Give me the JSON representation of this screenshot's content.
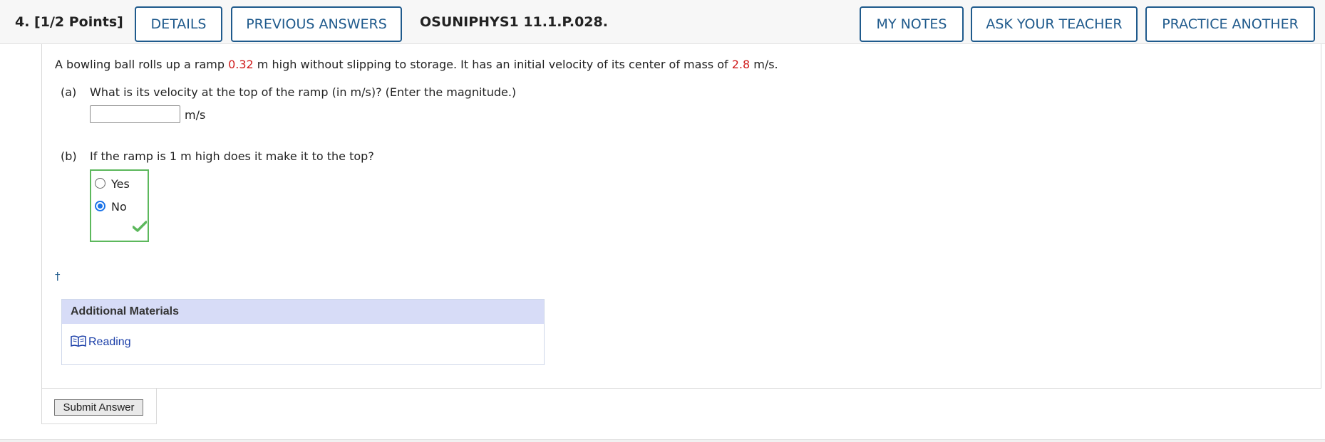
{
  "header": {
    "question_label": "4.  [1/2 Points]",
    "details_label": "DETAILS",
    "previous_answers_label": "PREVIOUS ANSWERS",
    "question_code": "OSUNIPHYS1 11.1.P.028.",
    "my_notes_label": "MY NOTES",
    "ask_teacher_label": "ASK YOUR TEACHER",
    "practice_another_label": "PRACTICE ANOTHER"
  },
  "problem": {
    "intro_part1": "A bowling ball rolls up a ramp ",
    "height_value": "0.32",
    "intro_part2": " m high without slipping to storage. It has an initial velocity of its center of mass of ",
    "velocity_value": "2.8",
    "intro_part3": " m/s."
  },
  "part_a": {
    "label": "(a)",
    "question": "What is its velocity at the top of the ramp (in m/s)? (Enter the magnitude.)",
    "input_value": "",
    "unit": "m/s"
  },
  "part_b": {
    "label": "(b)",
    "question": "If the ramp is 1 m high does it make it to the top?",
    "options": [
      "Yes",
      "No"
    ],
    "selected": "No",
    "status": "correct"
  },
  "dagger": "†",
  "additional_materials": {
    "title": "Additional Materials",
    "reading_label": "Reading"
  },
  "submit_label": "Submit Answer",
  "colors": {
    "accent": "#1f5a8c",
    "highlight_red": "#d01b1b",
    "correct_green": "#5cb85c",
    "materials_header": "#d7dcf7"
  }
}
